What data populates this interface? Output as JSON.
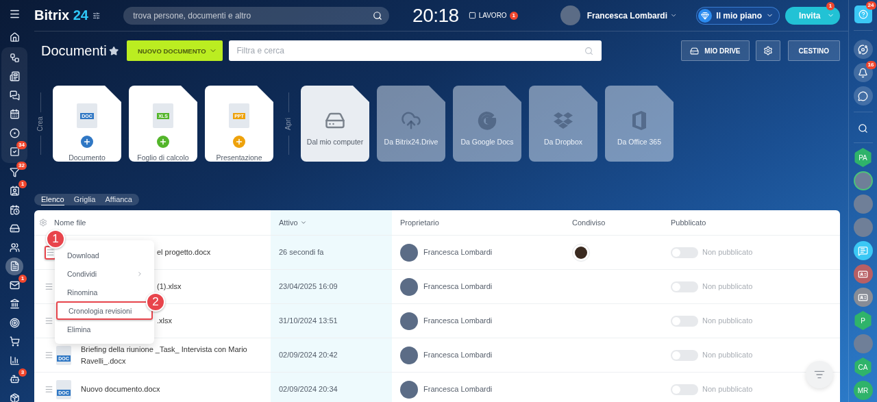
{
  "logo": {
    "name": "Bitrix",
    "number": "24"
  },
  "top_search": {
    "placeholder": "trova persone, documenti e altro"
  },
  "clock": "20:18",
  "work_status": {
    "label": "LAVORO",
    "badge": "1"
  },
  "user": {
    "name": "Francesca Lombardi"
  },
  "plan_button": {
    "label": "Il mio piano"
  },
  "invite_button": {
    "label": "Invita",
    "badge": "1"
  },
  "left_rail": {
    "top": [
      {
        "selected": false
      }
    ],
    "pinned": [
      {
        "selected": false
      },
      {
        "selected": false
      },
      {
        "selected": false
      },
      {
        "selected": false
      },
      {
        "selected": false
      },
      {
        "selected": false,
        "badge": "34"
      }
    ],
    "items": [
      {
        "selected": false,
        "badge": "32"
      },
      {
        "selected": false,
        "badge": "1"
      },
      {
        "selected": false
      },
      {
        "selected": false
      },
      {
        "selected": false
      },
      {
        "selected": true
      },
      {
        "selected": false,
        "badge": "1"
      },
      {
        "selected": false
      },
      {
        "selected": false
      },
      {
        "selected": false
      },
      {
        "selected": false
      },
      {
        "selected": false,
        "badge": "3"
      },
      {
        "selected": false
      }
    ]
  },
  "right_rail": {
    "help_badge": "24",
    "tools": [
      {
        "kind": "app"
      },
      {
        "kind": "bell",
        "badge": "16"
      },
      {
        "kind": "chat"
      }
    ],
    "contacts": [
      {
        "kind": "hex",
        "initials": "PA"
      },
      {
        "kind": "photo",
        "ring": true
      },
      {
        "kind": "photo",
        "ring": false
      },
      {
        "kind": "photo",
        "ring": false
      },
      {
        "kind": "chat"
      },
      {
        "kind": "card",
        "color": "#b85f64"
      },
      {
        "kind": "card",
        "color": "#878c96"
      },
      {
        "kind": "hex",
        "initials": "P"
      },
      {
        "kind": "photo",
        "ring": false
      },
      {
        "kind": "hex",
        "initials": "CA"
      },
      {
        "kind": "circle",
        "initials": "MR"
      }
    ]
  },
  "page_title": "Documenti",
  "new_button": {
    "label": "NUOVO DOCUMENTO"
  },
  "filter": {
    "placeholder": "Filtra e cerca"
  },
  "drive_button": {
    "label": "MIO DRIVE"
  },
  "trash_button": {
    "label": "CESTINO"
  },
  "create_label": "Crea",
  "create_cards": [
    {
      "type": "DOC",
      "color": "#2f77c4",
      "label": "Documento"
    },
    {
      "type": "XLS",
      "color": "#53b52a",
      "label": "Foglio di calcolo"
    },
    {
      "type": "PPT",
      "color": "#eea20c",
      "label": "Presentazione"
    }
  ],
  "open_label": "Apri",
  "open_cards": [
    {
      "kind": "computer",
      "label": "Dal mio computer",
      "highlighted": true
    },
    {
      "kind": "cloud",
      "label": "Da Bitrix24.Drive",
      "highlighted": false
    },
    {
      "kind": "google",
      "label": "Da Google Docs",
      "highlighted": false
    },
    {
      "kind": "dropbox",
      "label": "Da Dropbox",
      "highlighted": false
    },
    {
      "kind": "office",
      "label": "Da Office 365",
      "highlighted": false
    }
  ],
  "view_tabs": [
    {
      "label": "Elenco",
      "selected": true
    },
    {
      "label": "Griglia",
      "selected": false
    },
    {
      "label": "Affianca",
      "selected": false
    }
  ],
  "table": {
    "columns": [
      {
        "label": "Nome file",
        "sorted": false
      },
      {
        "label": "Attivo",
        "sorted": true
      },
      {
        "label": "Proprietario",
        "sorted": false
      },
      {
        "label": "Condiviso",
        "sorted": false
      },
      {
        "label": "Pubblicato",
        "sorted": false
      }
    ],
    "rows": [
      {
        "name": "el progetto.docx",
        "active": "26 secondi fa",
        "owner": "Francesca Lombardi",
        "shared": true,
        "published": false,
        "status": "Non pubblicato",
        "highlighted": true
      },
      {
        "name": "(1).xlsx",
        "active": "23/04/2025 16:09",
        "owner": "Francesca Lombardi",
        "shared": false,
        "published": false,
        "status": "Non pubblicato",
        "highlighted": false
      },
      {
        "name": ".xlsx",
        "active": "31/10/2024 13:51",
        "owner": "Francesca Lombardi",
        "shared": false,
        "published": false,
        "status": "Non pubblicato",
        "highlighted": false
      },
      {
        "name": "Briefing della riunione _Task_ Intervista con Mario Ravelli_.docx",
        "file_type": "DOC",
        "active": "02/09/2024 20:42",
        "owner": "Francesca Lombardi",
        "shared": false,
        "published": false,
        "status": "Non pubblicato",
        "highlighted": false
      },
      {
        "name": "Nuovo documento.docx",
        "file_type": "DOC",
        "active": "02/09/2024 20:34",
        "owner": "Francesca Lombardi",
        "shared": false,
        "published": false,
        "status": "Non pubblicato",
        "highlighted": false
      }
    ]
  },
  "context_menu": {
    "items": [
      {
        "label": "Download",
        "submenu": false,
        "highlighted": false
      },
      {
        "label": "Condividi",
        "submenu": true,
        "highlighted": false
      },
      {
        "label": "Rinomina",
        "submenu": false,
        "highlighted": false
      },
      {
        "label": "Cronologia revisioni",
        "submenu": false,
        "highlighted": true
      },
      {
        "label": "Elimina",
        "submenu": false,
        "highlighted": false
      }
    ]
  },
  "step_markers": [
    {
      "label": "1"
    },
    {
      "label": "2"
    }
  ]
}
